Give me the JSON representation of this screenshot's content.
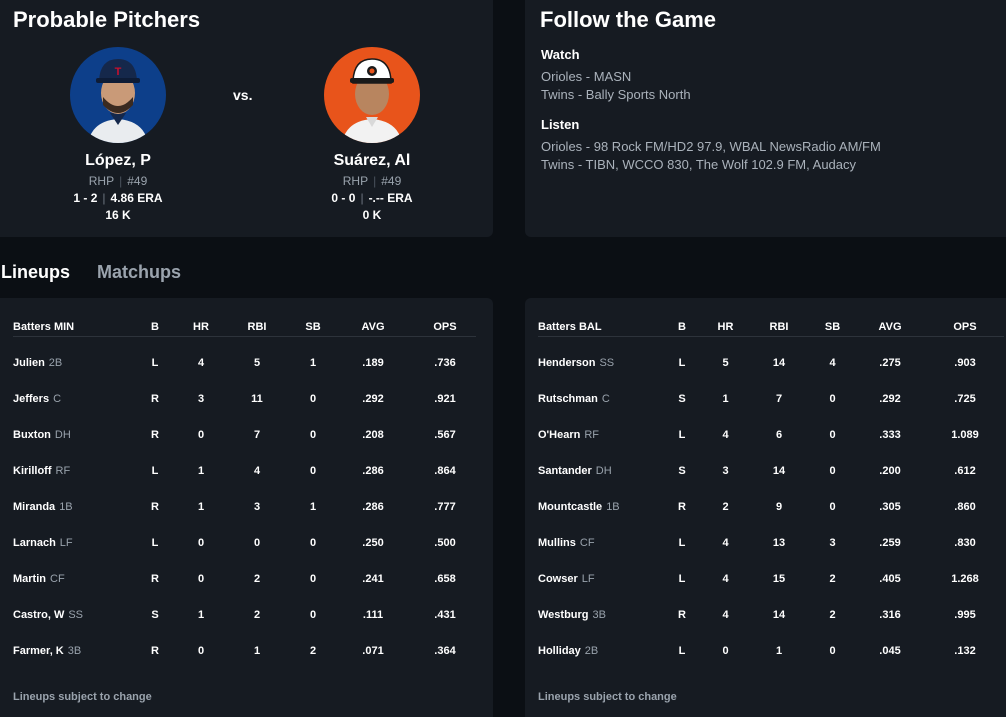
{
  "pitchers": {
    "title": "Probable Pitchers",
    "vs": "vs.",
    "home": {
      "name": "López, P",
      "throws": "RHP",
      "number": "#49",
      "record": "1 - 2",
      "era": "4.86 ERA",
      "strikeouts": "16 K",
      "avatar_color": "#0d3f8a",
      "icon": "player-headshot-icon"
    },
    "away": {
      "name": "Suárez, Al",
      "throws": "RHP",
      "number": "#49",
      "record": "0 - 0",
      "era": "-.-- ERA",
      "strikeouts": "0 K",
      "avatar_color": "#e8541b",
      "icon": "player-headshot-icon"
    }
  },
  "follow": {
    "title": "Follow the Game",
    "watch": {
      "heading": "Watch",
      "lines": [
        "Orioles - MASN",
        "Twins - Bally Sports North"
      ]
    },
    "listen": {
      "heading": "Listen",
      "lines": [
        "Orioles - 98 Rock FM/HD2 97.9, WBAL NewsRadio AM/FM",
        "Twins - TIBN, WCCO 830, The Wolf 102.9 FM, Audacy"
      ]
    }
  },
  "tabs": [
    {
      "label": "Lineups",
      "active": true
    },
    {
      "label": "Matchups",
      "active": false
    }
  ],
  "columns": [
    "B",
    "HR",
    "RBI",
    "SB",
    "AVG",
    "OPS"
  ],
  "lineups": {
    "min": {
      "header": "Batters MIN",
      "footnote": "Lineups subject to change",
      "rows": [
        {
          "name": "Julien",
          "pos": "2B",
          "b": "L",
          "hr": "4",
          "rbi": "5",
          "sb": "1",
          "avg": ".189",
          "ops": ".736"
        },
        {
          "name": "Jeffers",
          "pos": "C",
          "b": "R",
          "hr": "3",
          "rbi": "11",
          "sb": "0",
          "avg": ".292",
          "ops": ".921"
        },
        {
          "name": "Buxton",
          "pos": "DH",
          "b": "R",
          "hr": "0",
          "rbi": "7",
          "sb": "0",
          "avg": ".208",
          "ops": ".567"
        },
        {
          "name": "Kirilloff",
          "pos": "RF",
          "b": "L",
          "hr": "1",
          "rbi": "4",
          "sb": "0",
          "avg": ".286",
          "ops": ".864"
        },
        {
          "name": "Miranda",
          "pos": "1B",
          "b": "R",
          "hr": "1",
          "rbi": "3",
          "sb": "1",
          "avg": ".286",
          "ops": ".777"
        },
        {
          "name": "Larnach",
          "pos": "LF",
          "b": "L",
          "hr": "0",
          "rbi": "0",
          "sb": "0",
          "avg": ".250",
          "ops": ".500"
        },
        {
          "name": "Martin",
          "pos": "CF",
          "b": "R",
          "hr": "0",
          "rbi": "2",
          "sb": "0",
          "avg": ".241",
          "ops": ".658"
        },
        {
          "name": "Castro, W",
          "pos": "SS",
          "b": "S",
          "hr": "1",
          "rbi": "2",
          "sb": "0",
          "avg": ".111",
          "ops": ".431"
        },
        {
          "name": "Farmer, K",
          "pos": "3B",
          "b": "R",
          "hr": "0",
          "rbi": "1",
          "sb": "2",
          "avg": ".071",
          "ops": ".364"
        }
      ]
    },
    "bal": {
      "header": "Batters BAL",
      "footnote": "Lineups subject to change",
      "rows": [
        {
          "name": "Henderson",
          "pos": "SS",
          "b": "L",
          "hr": "5",
          "rbi": "14",
          "sb": "4",
          "avg": ".275",
          "ops": ".903"
        },
        {
          "name": "Rutschman",
          "pos": "C",
          "b": "S",
          "hr": "1",
          "rbi": "7",
          "sb": "0",
          "avg": ".292",
          "ops": ".725"
        },
        {
          "name": "O'Hearn",
          "pos": "RF",
          "b": "L",
          "hr": "4",
          "rbi": "6",
          "sb": "0",
          "avg": ".333",
          "ops": "1.089"
        },
        {
          "name": "Santander",
          "pos": "DH",
          "b": "S",
          "hr": "3",
          "rbi": "14",
          "sb": "0",
          "avg": ".200",
          "ops": ".612"
        },
        {
          "name": "Mountcastle",
          "pos": "1B",
          "b": "R",
          "hr": "2",
          "rbi": "9",
          "sb": "0",
          "avg": ".305",
          "ops": ".860"
        },
        {
          "name": "Mullins",
          "pos": "CF",
          "b": "L",
          "hr": "4",
          "rbi": "13",
          "sb": "3",
          "avg": ".259",
          "ops": ".830"
        },
        {
          "name": "Cowser",
          "pos": "LF",
          "b": "L",
          "hr": "4",
          "rbi": "15",
          "sb": "2",
          "avg": ".405",
          "ops": "1.268"
        },
        {
          "name": "Westburg",
          "pos": "3B",
          "b": "R",
          "hr": "4",
          "rbi": "14",
          "sb": "2",
          "avg": ".316",
          "ops": ".995"
        },
        {
          "name": "Holliday",
          "pos": "2B",
          "b": "L",
          "hr": "0",
          "rbi": "1",
          "sb": "0",
          "avg": ".045",
          "ops": ".132"
        }
      ]
    }
  }
}
